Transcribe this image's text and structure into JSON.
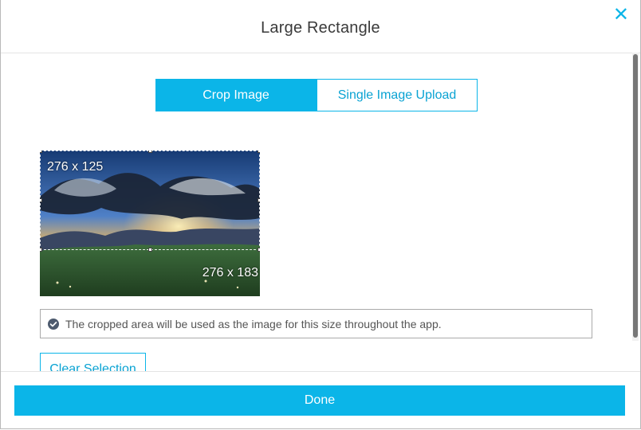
{
  "modal": {
    "title": "Large Rectangle",
    "close_icon": "close-icon",
    "accent_color": "#0bb5e8"
  },
  "tabs": [
    {
      "label": "Crop Image",
      "active": true
    },
    {
      "label": "Single Image Upload",
      "active": false
    }
  ],
  "crop": {
    "selection_size": "276 x 125",
    "image_size": "276 x 183",
    "image_description": "landscape-sunset"
  },
  "info": {
    "icon": "check-circle-icon",
    "text": "The cropped area will be used as the image for this size throughout the app."
  },
  "buttons": {
    "clear_selection": "Clear Selection",
    "done": "Done"
  }
}
